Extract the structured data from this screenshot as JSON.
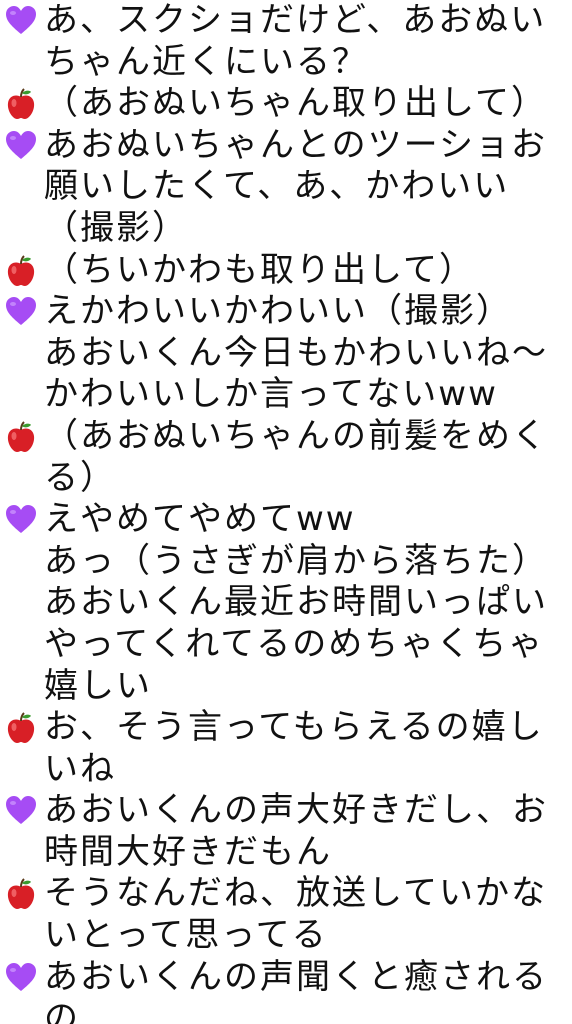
{
  "colors": {
    "heart": "#a64cf4",
    "apple": "#d81f26",
    "text": "#111111",
    "background": "#ffffff"
  },
  "icons": {
    "heart": "purple-heart-icon",
    "apple": "red-apple-icon"
  },
  "lines": [
    {
      "speaker": "heart",
      "text": "あ、スクショだけど、あおぬいちゃん近くにいる？"
    },
    {
      "speaker": "apple",
      "text": "（あおぬいちゃん取り出して）"
    },
    {
      "speaker": "heart",
      "text": "あおぬいちゃんとのツーショお願いしたくて、あ、かわいい（撮影）"
    },
    {
      "speaker": "apple",
      "text": "（ちいかわも取り出して）"
    },
    {
      "speaker": "heart",
      "text": "えかわいいかわいい（撮影）"
    },
    {
      "speaker": "none",
      "text": "あおいくん今日もかわいいね～かわいいしか言ってないww"
    },
    {
      "speaker": "apple",
      "text": "（あおぬいちゃんの前髪をめくる）"
    },
    {
      "speaker": "heart",
      "text": "えやめてやめてww"
    },
    {
      "speaker": "none",
      "text": "あっ（うさぎが肩から落ちた）"
    },
    {
      "speaker": "none",
      "text": "あおいくん最近お時間いっぱいやってくれてるのめちゃくちゃ嬉しい"
    },
    {
      "speaker": "apple",
      "text": "お、そう言ってもらえるの嬉しいね"
    },
    {
      "speaker": "heart",
      "text": "あおいくんの声大好きだし、お時間大好きだもん"
    },
    {
      "speaker": "apple",
      "text": "そうなんだね、放送していかないとって思ってる"
    },
    {
      "speaker": "heart",
      "text": "あおいくんの声聞くと癒されるの"
    }
  ]
}
